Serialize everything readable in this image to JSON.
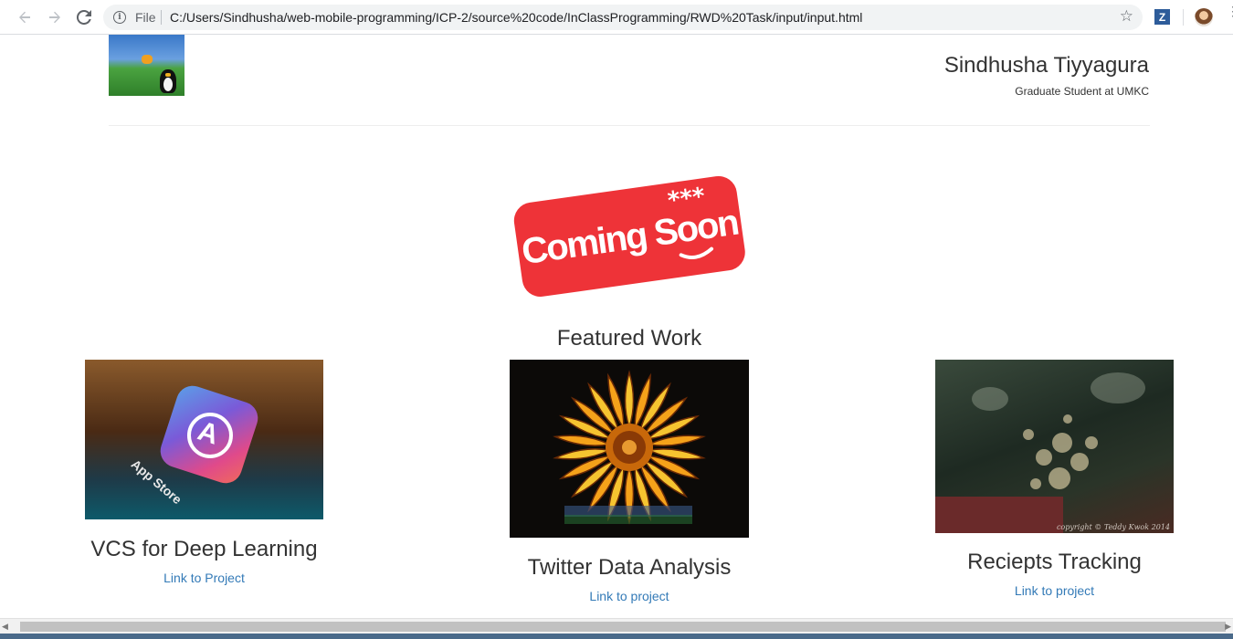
{
  "browser": {
    "scheme_label": "File",
    "url": "C:/Users/Sindhusha/web-mobile-programming/ICP-2/source%20code/InClassProgramming/RWD%20Task/input/input.html",
    "extension_letter": "Z"
  },
  "header": {
    "name": "Sindhusha Tiyyagura",
    "subtitle": "Graduate Student at UMKC"
  },
  "banner": {
    "text": "Coming Soon"
  },
  "featured": {
    "heading": "Featured Work",
    "projects": [
      {
        "title": "VCS for Deep Learning",
        "link_label": "Link to Project",
        "thumb_caption": "App Store"
      },
      {
        "title": "Twitter Data Analysis",
        "link_label": "Link to project"
      },
      {
        "title": "Reciepts Tracking",
        "link_label": "Link to project",
        "thumb_caption": "copyright © Teddy Kwok 2014"
      }
    ]
  },
  "colors": {
    "link": "#337ab7",
    "text": "#333333",
    "banner_red": "#ee3338"
  }
}
